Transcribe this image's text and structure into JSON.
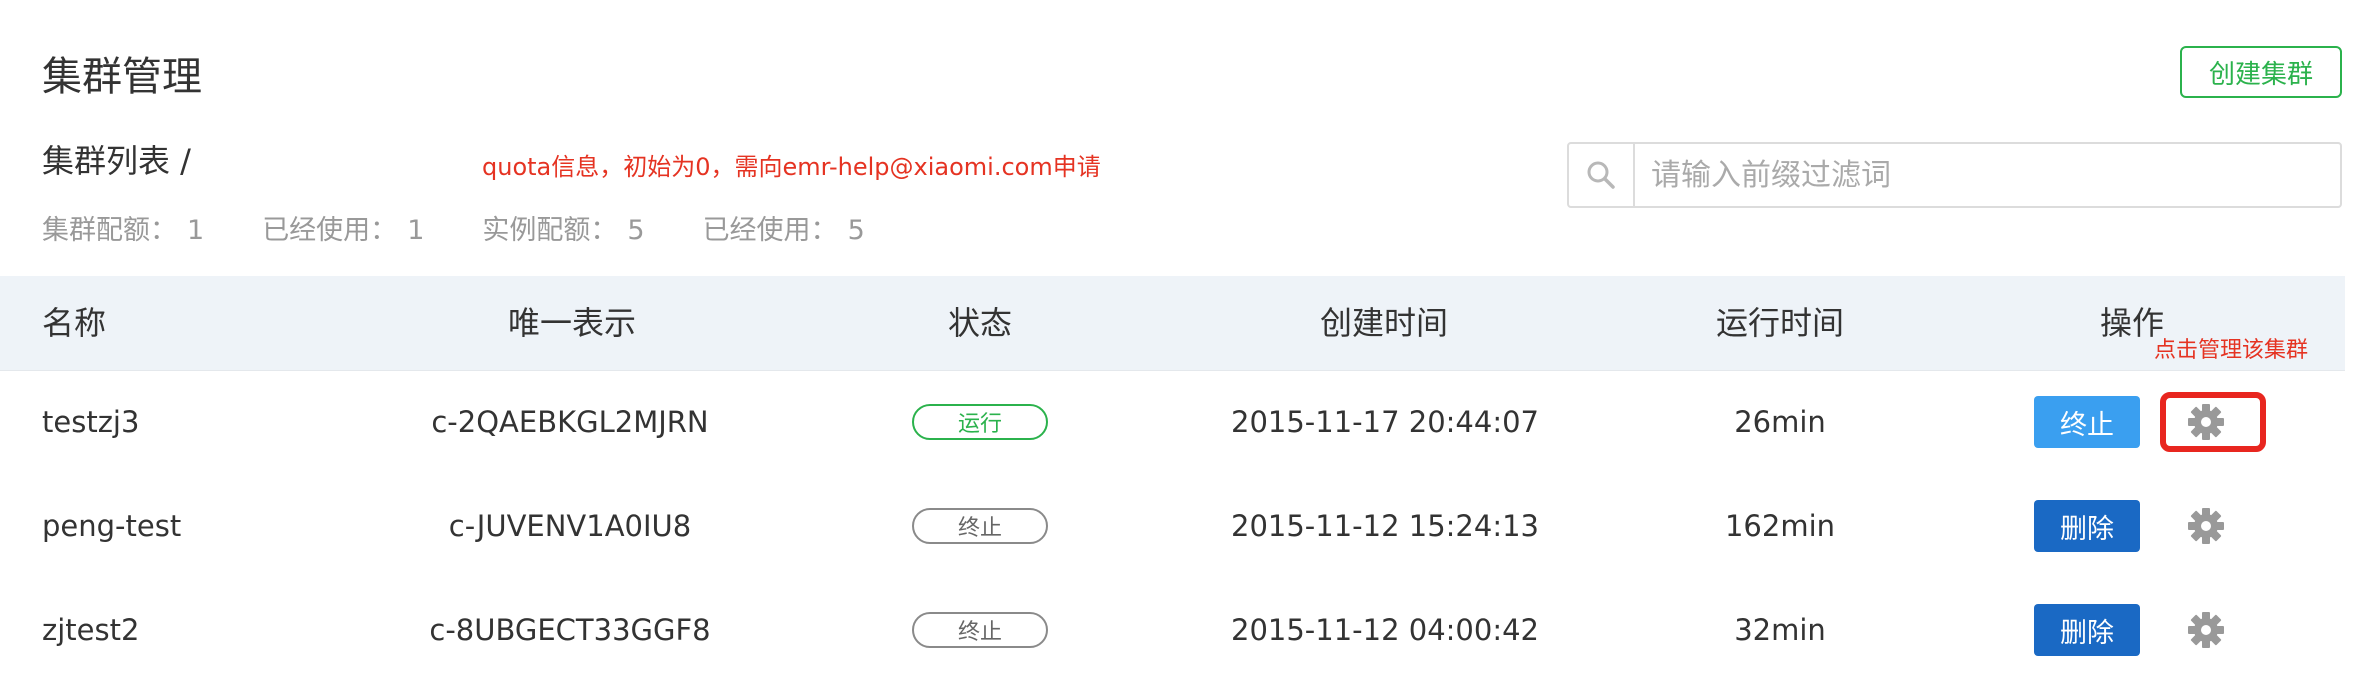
{
  "header": {
    "title": "集群管理",
    "create_button": "创建集群"
  },
  "list_section": {
    "title": "集群列表 /",
    "note": "quota信息，初始为0，需向emr-help@xiaomi.com申请"
  },
  "search": {
    "placeholder": "请输入前缀过滤词",
    "value": ""
  },
  "quota": [
    {
      "label": "集群配额：",
      "value": "1"
    },
    {
      "label": "已经使用：",
      "value": "1"
    },
    {
      "label": "实例配额：",
      "value": "5"
    },
    {
      "label": "已经使用：",
      "value": "5"
    }
  ],
  "table": {
    "columns": [
      "名称",
      "唯一表示",
      "状态",
      "创建时间",
      "运行时间",
      "操作"
    ],
    "rows": [
      {
        "name": "testzj3",
        "id": "c-2QAEBKGL2MJRN",
        "status": "运行",
        "status_type": "running",
        "created": "2015-11-17 20:44:07",
        "runtime": "26min",
        "action": "终止",
        "action_type": "stop"
      },
      {
        "name": "peng-test",
        "id": "c-JUVENV1A0IU8",
        "status": "终止",
        "status_type": "stopped",
        "created": "2015-11-12 15:24:13",
        "runtime": "162min",
        "action": "删除",
        "action_type": "delete"
      },
      {
        "name": "zjtest2",
        "id": "c-8UBGECT33GGF8",
        "status": "终止",
        "status_type": "stopped",
        "created": "2015-11-12 04:00:42",
        "runtime": "32min",
        "action": "删除",
        "action_type": "delete"
      }
    ]
  },
  "annotation": {
    "manage_note": "点击管理该集群"
  },
  "colors": {
    "green": "#2bb24c",
    "red_note": "#e53322",
    "header_bg": "#eef3f8",
    "btn_stop": "#3a9ff0",
    "btn_delete": "#1a69c4",
    "gear": "#999999"
  }
}
